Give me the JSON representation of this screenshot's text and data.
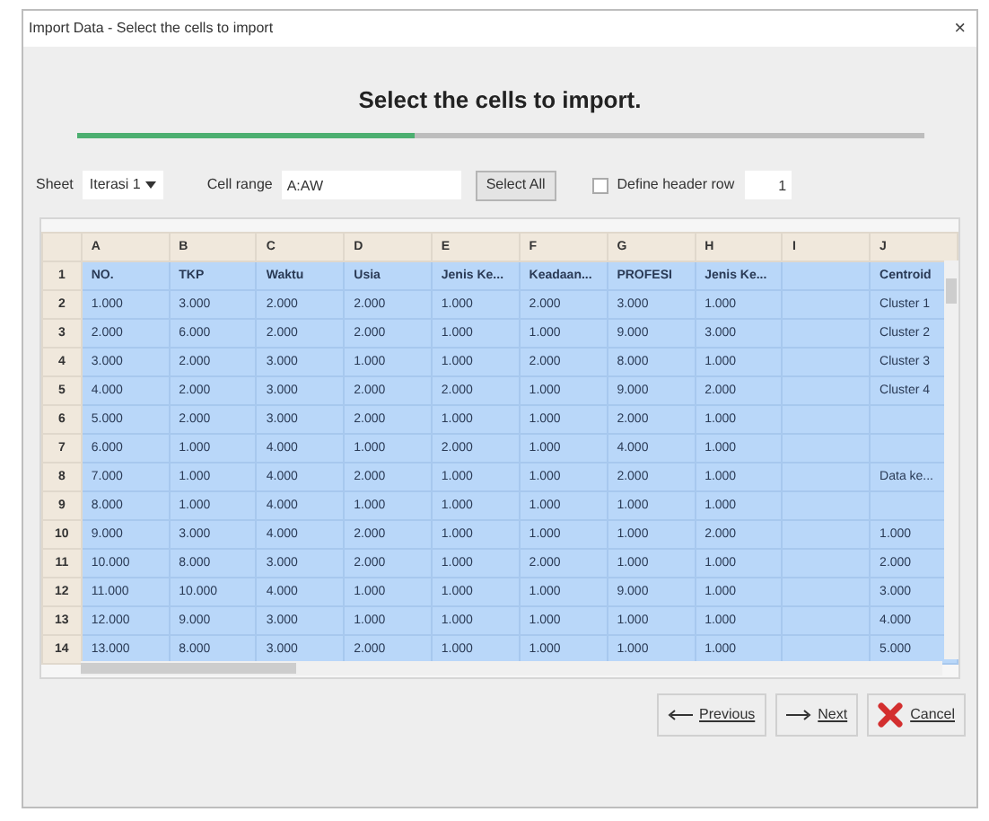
{
  "window": {
    "title": "Import Data - Select the cells to import",
    "close": "×"
  },
  "heading": "Select the cells to import.",
  "progress": {
    "level": 0.4
  },
  "controls": {
    "sheet_label": "Sheet",
    "sheet_value": "Iterasi 1",
    "cell_range_label": "Cell range",
    "cell_range_value": "A:AW",
    "select_all": "Select All",
    "define_header": {
      "label": "Define header row",
      "checked": false
    },
    "header_row": "1"
  },
  "table": {
    "columns": [
      "A",
      "B",
      "C",
      "D",
      "E",
      "F",
      "G",
      "H",
      "I",
      "J"
    ],
    "rows": [
      {
        "number": "1",
        "kind": "header",
        "selected": true,
        "cells": [
          "NO.",
          "TKP",
          "Waktu",
          "Usia",
          "Jenis Ke...",
          "Keadaan...",
          "PROFESI",
          "Jenis Ke...",
          "",
          "Centroid"
        ]
      },
      {
        "number": "2",
        "kind": "data",
        "selected": true,
        "cells": [
          "1.000",
          "3.000",
          "2.000",
          "2.000",
          "1.000",
          "2.000",
          "3.000",
          "1.000",
          "",
          "Cluster 1"
        ]
      },
      {
        "number": "3",
        "kind": "data",
        "selected": true,
        "cells": [
          "2.000",
          "6.000",
          "2.000",
          "2.000",
          "1.000",
          "1.000",
          "9.000",
          "3.000",
          "",
          "Cluster 2"
        ]
      },
      {
        "number": "4",
        "kind": "data",
        "selected": true,
        "cells": [
          "3.000",
          "2.000",
          "3.000",
          "1.000",
          "1.000",
          "2.000",
          "8.000",
          "1.000",
          "",
          "Cluster 3"
        ]
      },
      {
        "number": "5",
        "kind": "data",
        "selected": true,
        "cells": [
          "4.000",
          "2.000",
          "3.000",
          "2.000",
          "2.000",
          "1.000",
          "9.000",
          "2.000",
          "",
          "Cluster 4"
        ]
      },
      {
        "number": "6",
        "kind": "data",
        "selected": true,
        "cells": [
          "5.000",
          "2.000",
          "3.000",
          "2.000",
          "1.000",
          "1.000",
          "2.000",
          "1.000",
          "",
          ""
        ]
      },
      {
        "number": "7",
        "kind": "data",
        "selected": true,
        "cells": [
          "6.000",
          "1.000",
          "4.000",
          "1.000",
          "2.000",
          "1.000",
          "4.000",
          "1.000",
          "",
          ""
        ]
      },
      {
        "number": "8",
        "kind": "data",
        "selected": true,
        "cells": [
          "7.000",
          "1.000",
          "4.000",
          "2.000",
          "1.000",
          "1.000",
          "2.000",
          "1.000",
          "",
          "Data ke..."
        ]
      },
      {
        "number": "9",
        "kind": "data",
        "selected": true,
        "cells": [
          "8.000",
          "1.000",
          "4.000",
          "1.000",
          "1.000",
          "1.000",
          "1.000",
          "1.000",
          "",
          ""
        ]
      },
      {
        "number": "10",
        "kind": "data",
        "selected": true,
        "cells": [
          "9.000",
          "3.000",
          "4.000",
          "2.000",
          "1.000",
          "1.000",
          "1.000",
          "2.000",
          "",
          "1.000"
        ]
      },
      {
        "number": "11",
        "kind": "data",
        "selected": true,
        "cells": [
          "10.000",
          "8.000",
          "3.000",
          "2.000",
          "1.000",
          "2.000",
          "1.000",
          "1.000",
          "",
          "2.000"
        ]
      },
      {
        "number": "12",
        "kind": "data",
        "selected": true,
        "cells": [
          "11.000",
          "10.000",
          "4.000",
          "1.000",
          "1.000",
          "1.000",
          "9.000",
          "1.000",
          "",
          "3.000"
        ]
      },
      {
        "number": "13",
        "kind": "data",
        "selected": true,
        "cells": [
          "12.000",
          "9.000",
          "3.000",
          "1.000",
          "1.000",
          "1.000",
          "1.000",
          "1.000",
          "",
          "4.000"
        ]
      },
      {
        "number": "14",
        "kind": "data",
        "selected": true,
        "cells": [
          "13.000",
          "8.000",
          "3.000",
          "2.000",
          "1.000",
          "1.000",
          "1.000",
          "1.000",
          "",
          "5.000"
        ]
      }
    ]
  },
  "buttons": [
    {
      "label": "Previous",
      "kind": "previous"
    },
    {
      "label": "Next",
      "kind": "next"
    },
    {
      "label": "Cancel",
      "kind": "cancel"
    }
  ]
}
